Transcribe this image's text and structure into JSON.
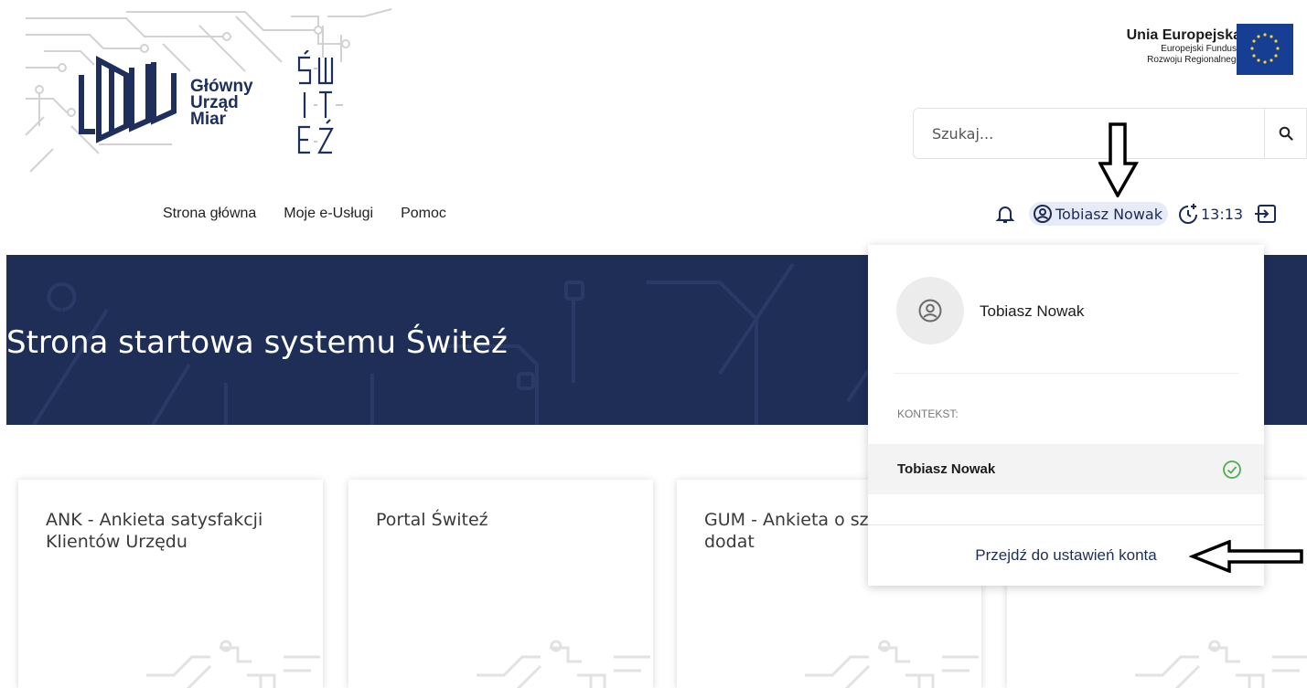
{
  "header": {
    "org_name_line1": "Główny",
    "org_name_line2": "Urząd",
    "org_name_line3": "Miar",
    "eu_title": "Unia Europejska",
    "eu_sub1": "Europejski Fundusz",
    "eu_sub2": "Rozwoju Regionalnego"
  },
  "search": {
    "placeholder": "Szukaj..."
  },
  "nav": {
    "items": [
      {
        "label": "Strona główna"
      },
      {
        "label": "Moje e-Usługi"
      },
      {
        "label": "Pomoc"
      }
    ]
  },
  "userbar": {
    "user_name": "Tobiasz Nowak",
    "session_time": "13:13"
  },
  "hero": {
    "title": "Strona startowa systemu Świteź"
  },
  "cards": [
    {
      "title": "ANK - Ankieta satysfakcji Klientów Urzędu"
    },
    {
      "title": "Portal Świteź"
    },
    {
      "title": "GUM - Ankieta o szkolenia dodat"
    },
    {
      "title": ""
    }
  ],
  "dropdown": {
    "user_name": "Tobiasz Nowak",
    "context_label": "KONTEKST:",
    "context_item": "Tobiasz Nowak",
    "settings_link": "Przejdź do ustawień konta"
  },
  "colors": {
    "navy": "#1f2e57",
    "accent_green": "#4caf50",
    "chip_bg": "#e7ebf8"
  },
  "icons": [
    "search-icon",
    "bell-icon",
    "user-circle-icon",
    "timer-icon",
    "logout-icon",
    "check-circle-icon"
  ]
}
